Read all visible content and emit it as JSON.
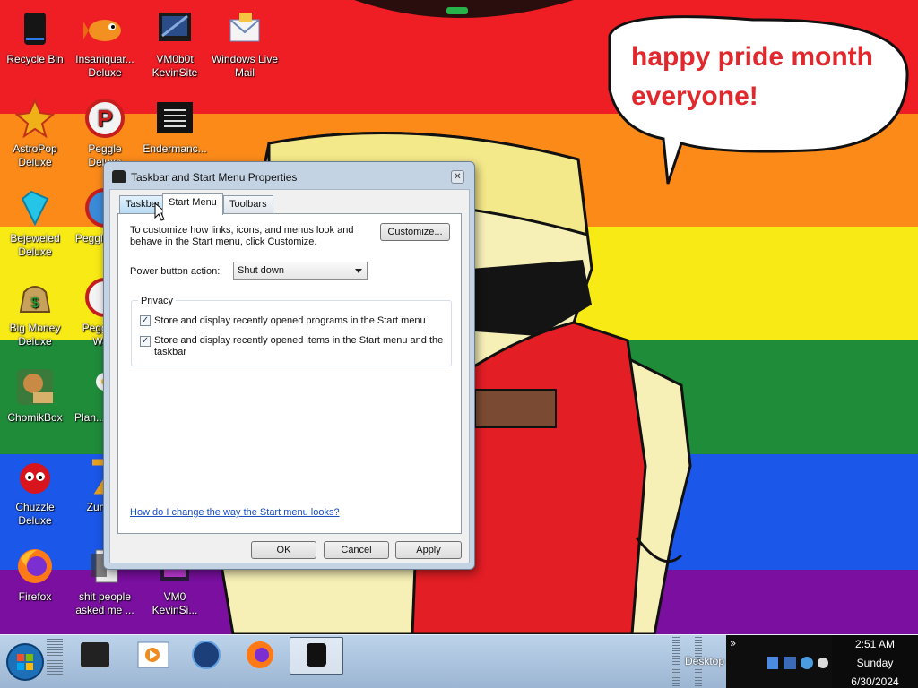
{
  "desktop": {
    "stripe_colors": [
      "#ef1d24",
      "#fb8a19",
      "#f8ea14",
      "#1f8c3a",
      "#1b57e9",
      "#7a0fa0"
    ],
    "bubble_text": [
      "happy pride month",
      "everyone!"
    ],
    "icons": [
      {
        "label": "Recycle Bin",
        "name": "recycle-bin-icon"
      },
      {
        "label": "Insaniquar... Deluxe",
        "name": "insaniquarium-icon"
      },
      {
        "label": "VM0b0t KevinSite",
        "name": "vm0b0t-icon"
      },
      {
        "label": "Windows Live Mail",
        "name": "windows-live-mail-icon"
      },
      {
        "label": "AstroPop Deluxe",
        "name": "astropop-icon"
      },
      {
        "label": "Peggle Deluxe",
        "name": "peggle-icon"
      },
      {
        "label": "Endermanc...",
        "name": "endermanch-icon"
      },
      {
        "label": "Bejeweled Deluxe",
        "name": "bejeweled-icon"
      },
      {
        "label": "Peggle De...",
        "name": "peggle-2-icon"
      },
      {
        "label": "Big Money Deluxe",
        "name": "big-money-icon"
      },
      {
        "label": "Peggle of Wa...",
        "name": "peggle-nights-icon"
      },
      {
        "label": "ChomikBox",
        "name": "chomikbox-icon"
      },
      {
        "label": "Plan... Zon...",
        "name": "plants-vs-zombies-icon"
      },
      {
        "label": "Chuzzle Deluxe",
        "name": "chuzzle-icon"
      },
      {
        "label": "Zuma...",
        "name": "zuma-icon"
      },
      {
        "label": "Firefox",
        "name": "firefox-icon"
      },
      {
        "label": "shit people asked me ...",
        "name": "file-icon"
      },
      {
        "label": "VM0 KevinSi...",
        "name": "vm0-icon"
      }
    ]
  },
  "dialog": {
    "title": "Taskbar and Start Menu Properties",
    "close_glyph": "✕",
    "tabs": [
      "Taskbar",
      "Start Menu",
      "Toolbars"
    ],
    "intro": "To customize how links, icons, and menus look and behave in the Start menu, click Customize.",
    "customize_label": "Customize...",
    "power_label": "Power button action:",
    "power_value": "Shut down",
    "privacy_label": "Privacy",
    "check1": "Store and display recently opened programs in the Start menu",
    "check2": "Store and display recently opened items in the Start menu and the taskbar",
    "help_link": "How do I change the way the Start menu looks?",
    "ok": "OK",
    "cancel": "Cancel",
    "apply": "Apply"
  },
  "taskbar": {
    "desktop_label": "Desktop",
    "chevron": "»",
    "clock_time": "2:51 AM",
    "clock_day": "Sunday",
    "clock_date": "6/30/2024"
  }
}
